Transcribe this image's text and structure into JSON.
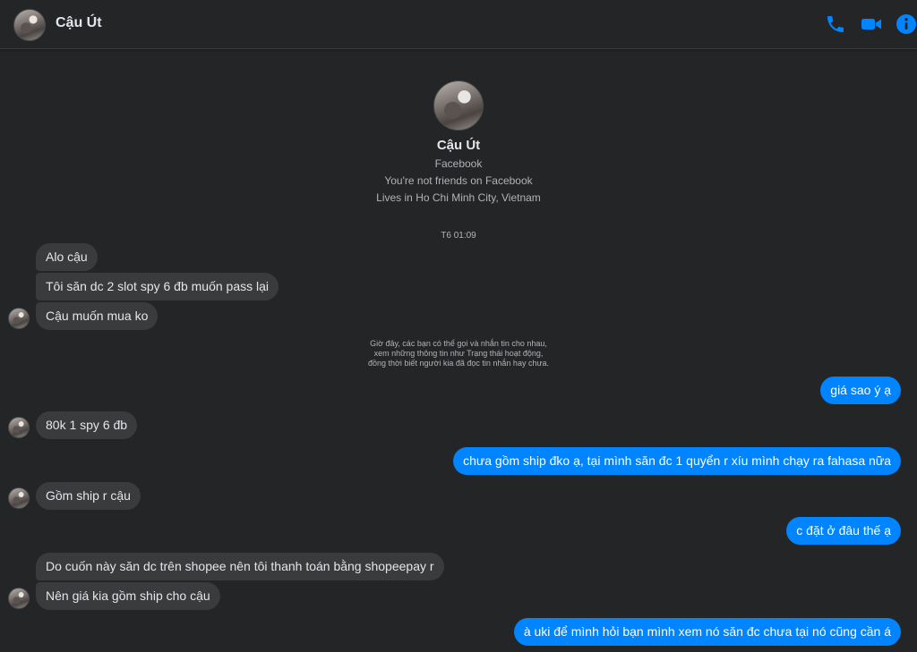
{
  "header": {
    "contact_name": "Cậu Út",
    "call_icon": "phone-icon",
    "video_icon": "video-camera-icon",
    "info_icon": "info-icon",
    "accent": "#0084ff"
  },
  "profile": {
    "name": "Cậu Út",
    "source": "Facebook",
    "friend_status": "You're not friends on Facebook",
    "lives_in": "Lives in Ho Chi Minh City, Vietnam"
  },
  "timestamp": "T6 01:09",
  "notice": {
    "line1": "Giờ đây, các bạn có thể gọi và nhắn tin cho nhau,",
    "line2": "xem những thông tin như Trạng thái hoạt động,",
    "line3": "đồng thời biết người kia đã đọc tin nhắn hay chưa."
  },
  "messages": [
    {
      "from": "them",
      "text": "Alo cậu"
    },
    {
      "from": "them",
      "text": "Tôi săn dc 2 slot spy 6 đb muốn pass lại"
    },
    {
      "from": "them",
      "text": "Cậu muốn mua ko"
    },
    {
      "from": "me",
      "text": "giá sao ý ạ"
    },
    {
      "from": "them",
      "text": "80k 1 spy 6 đb"
    },
    {
      "from": "me",
      "text": "chưa gồm ship đko ạ, tại mình săn đc 1 quyển r xíu mình chạy ra fahasa nữa"
    },
    {
      "from": "them",
      "text": "Gồm ship r cậu"
    },
    {
      "from": "me",
      "text": "c đặt ở đâu thế ạ"
    },
    {
      "from": "them",
      "text": "Do cuốn này săn dc trên shopee nên tôi thanh toán bằng shopeepay r"
    },
    {
      "from": "them",
      "text": "Nên giá kia gồm ship cho cậu"
    },
    {
      "from": "me",
      "text": "à uki để mình hỏi bạn mình xem nó săn đc chưa tại nó cũng cần á"
    }
  ]
}
